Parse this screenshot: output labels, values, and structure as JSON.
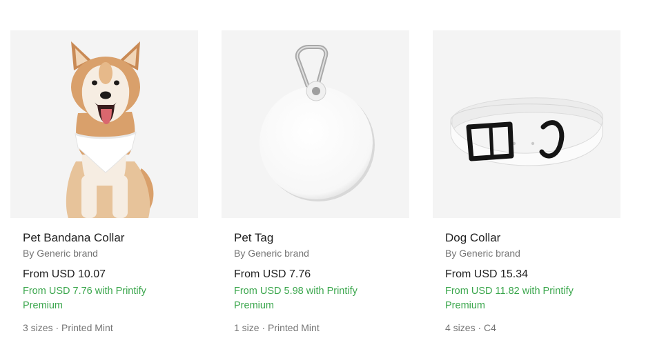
{
  "products": [
    {
      "name": "Pet Bandana Collar",
      "brand": "By Generic brand",
      "price": "From USD 10.07",
      "premium_price": "From USD 7.76 with Printify Premium",
      "meta": "3 sizes · Printed Mint",
      "image_icon": "dog-with-bandana-image"
    },
    {
      "name": "Pet Tag",
      "brand": "By Generic brand",
      "price": "From USD 7.76",
      "premium_price": "From USD 5.98 with Printify Premium",
      "meta": "1 size · Printed Mint",
      "image_icon": "round-pet-tag-image"
    },
    {
      "name": "Dog Collar",
      "brand": "By Generic brand",
      "price": "From USD 15.34",
      "premium_price": "From USD 11.82 with Printify Premium",
      "meta": "4 sizes · C4",
      "image_icon": "dog-collar-image"
    }
  ],
  "colors": {
    "thumb_bg": "#f4f4f4",
    "text_primary": "#212121",
    "text_secondary": "#757575",
    "premium_green": "#3aa64c"
  }
}
